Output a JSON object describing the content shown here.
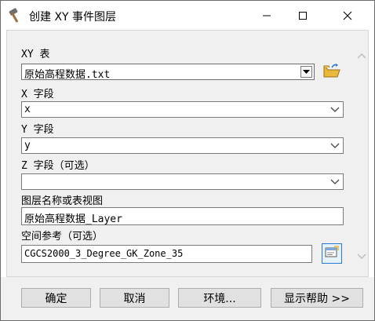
{
  "window": {
    "title": "创建 XY 事件图层"
  },
  "title_icon": "hammer-icon",
  "fields": {
    "xy_table": {
      "label": "XY 表",
      "value": "原始高程数据.txt"
    },
    "x_field": {
      "label": "X 字段",
      "value": "x"
    },
    "y_field": {
      "label": "Y 字段",
      "value": "y"
    },
    "z_field": {
      "label": "Z 字段（可选）",
      "value": ""
    },
    "layer_name": {
      "label": "图层名称或表视图",
      "value": "原始高程数据_Layer"
    },
    "spatial_ref": {
      "label": "空间参考（可选）",
      "value": "CGCS2000_3_Degree_GK_Zone_35"
    }
  },
  "buttons": {
    "ok": "确定",
    "cancel": "取消",
    "environments": "环境...",
    "show_help": "显示帮助 >>"
  },
  "colors": {
    "accent": "#2b79d8",
    "folder": "#e8b93a"
  }
}
